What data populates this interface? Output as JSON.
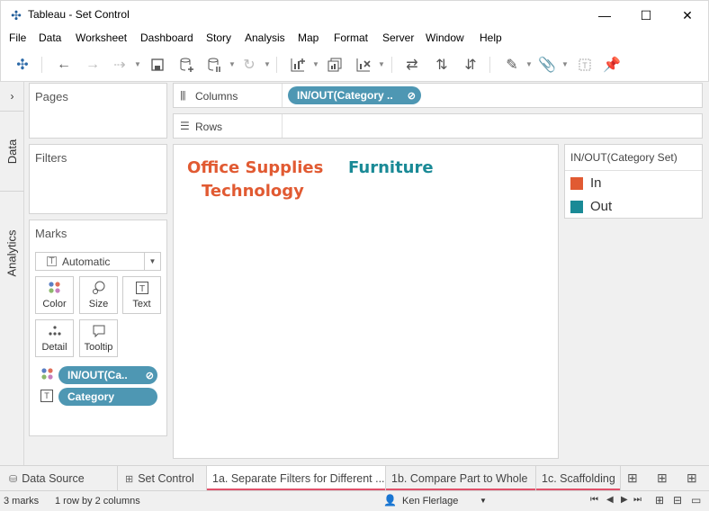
{
  "window": {
    "title": "Tableau - Set Control"
  },
  "menu": [
    "File",
    "Data",
    "Worksheet",
    "Dashboard",
    "Story",
    "Analysis",
    "Map",
    "Format",
    "Server",
    "Window",
    "Help"
  ],
  "side_tabs": {
    "data": "Data",
    "analytics": "Analytics"
  },
  "cards": {
    "pages": "Pages",
    "filters": "Filters",
    "marks": "Marks",
    "mark_type": "Automatic",
    "mark_buttons": {
      "color": "Color",
      "size": "Size",
      "text": "Text",
      "detail": "Detail",
      "tooltip": "Tooltip"
    },
    "mark_pills": [
      {
        "label": "IN/OUT(Ca..",
        "encoding": "color"
      },
      {
        "label": "Category",
        "encoding": "text"
      }
    ]
  },
  "shelves": {
    "columns_label": "Columns",
    "columns_pill": "IN/OUT(Category ..",
    "rows_label": "Rows"
  },
  "viz": {
    "marks": [
      {
        "text": "Office Supplies",
        "set": "In"
      },
      {
        "text": "Technology",
        "set": "In"
      },
      {
        "text": "Furniture",
        "set": "Out"
      }
    ]
  },
  "legend": {
    "title": "IN/OUT(Category Set)",
    "items": [
      {
        "label": "In",
        "color": "#e15a32"
      },
      {
        "label": "Out",
        "color": "#1a8a96"
      }
    ]
  },
  "bottom_tabs": {
    "data_source": "Data Source",
    "sheets": [
      {
        "label": "Set Control",
        "active": false,
        "underline": false
      },
      {
        "label": "1a. Separate Filters for Different ...",
        "active": true,
        "underline": true
      },
      {
        "label": "1b. Compare Part to Whole",
        "active": false,
        "underline": true
      },
      {
        "label": "1c. Scaffolding",
        "active": false,
        "underline": true
      }
    ]
  },
  "status": {
    "marks": "3 marks",
    "dims": "1 row by 2 columns",
    "user": "Ken Flerlage"
  }
}
